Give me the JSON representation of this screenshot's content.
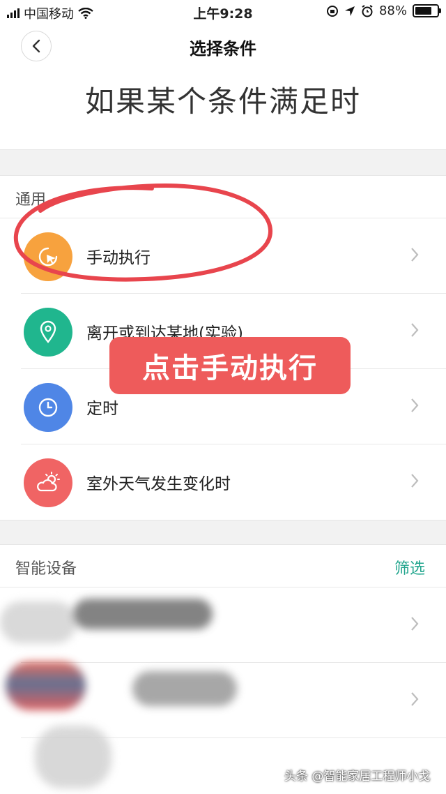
{
  "status_bar": {
    "carrier": "中国移动",
    "time": "上午9:28",
    "battery": "88%",
    "battery_level": 0.88
  },
  "nav": {
    "title": "选择条件",
    "back_icon": "chevron-left-icon"
  },
  "heading": "如果某个条件满足时",
  "general": {
    "title": "通用",
    "items": [
      {
        "label": "手动执行",
        "icon": "cursor-click-icon",
        "color": "#f7a23e"
      },
      {
        "label": "离开或到达某地(实验)",
        "icon": "location-pin-icon",
        "color": "#20b68e"
      },
      {
        "label": "定时",
        "icon": "clock-icon",
        "color": "#4f86e6"
      },
      {
        "label": "室外天气发生变化时",
        "icon": "weather-icon",
        "color": "#f06464"
      }
    ]
  },
  "devices": {
    "title": "智能设备",
    "filter": "筛选"
  },
  "annotation": {
    "callout": "点击手动执行"
  },
  "watermark": "头条 @智能家居工程师小戈"
}
